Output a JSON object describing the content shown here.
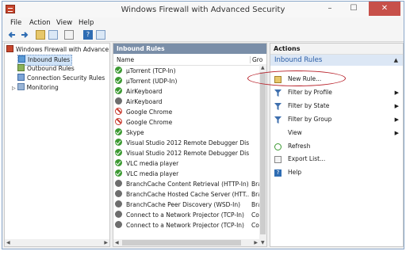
{
  "window": {
    "title": "Windows Firewall with Advanced Security",
    "minimize": "–",
    "maximize": "☐",
    "close": "✕"
  },
  "menu": [
    "File",
    "Action",
    "View",
    "Help"
  ],
  "tree": {
    "root": "Windows Firewall with Advance",
    "items": [
      "Inbound Rules",
      "Outbound Rules",
      "Connection Security Rules",
      "Monitoring"
    ]
  },
  "rules_pane": {
    "header": "Inbound Rules",
    "columns": {
      "name": "Name",
      "group": "Gro"
    },
    "rows": [
      {
        "name": "µTorrent (TCP-In)",
        "group": "",
        "status": "allow"
      },
      {
        "name": "µTorrent (UDP-In)",
        "group": "",
        "status": "allow"
      },
      {
        "name": "AirKeyboard",
        "group": "",
        "status": "allow"
      },
      {
        "name": "AirKeyboard",
        "group": "",
        "status": "none"
      },
      {
        "name": "Google Chrome",
        "group": "",
        "status": "block"
      },
      {
        "name": "Google Chrome",
        "group": "",
        "status": "block"
      },
      {
        "name": "Skype",
        "group": "",
        "status": "allow"
      },
      {
        "name": "Visual Studio 2012 Remote Debugger Dis...",
        "group": "",
        "status": "allow"
      },
      {
        "name": "Visual Studio 2012 Remote Debugger Dis...",
        "group": "",
        "status": "allow"
      },
      {
        "name": "VLC media player",
        "group": "",
        "status": "allow"
      },
      {
        "name": "VLC media player",
        "group": "",
        "status": "allow"
      },
      {
        "name": "BranchCache Content Retrieval (HTTP-In)",
        "group": "Bra",
        "status": "none"
      },
      {
        "name": "BranchCache Hosted Cache Server (HTT...",
        "group": "Bra",
        "status": "none"
      },
      {
        "name": "BranchCache Peer Discovery (WSD-In)",
        "group": "Bra",
        "status": "none"
      },
      {
        "name": "Connect to a Network Projector (TCP-In)",
        "group": "Co",
        "status": "none"
      },
      {
        "name": "Connect to a Network Projector (TCP-In)",
        "group": "Co",
        "status": "none"
      }
    ]
  },
  "actions_pane": {
    "title": "Actions",
    "section": "Inbound Rules",
    "items": [
      {
        "label": "New Rule...",
        "icon": "new-rule-icon",
        "submenu": false
      },
      {
        "label": "Filter by Profile",
        "icon": "filter-icon",
        "submenu": true
      },
      {
        "label": "Filter by State",
        "icon": "filter-icon",
        "submenu": true
      },
      {
        "label": "Filter by Group",
        "icon": "filter-icon",
        "submenu": true
      },
      {
        "label": "View",
        "icon": "",
        "submenu": true
      },
      {
        "label": "Refresh",
        "icon": "refresh-icon",
        "submenu": false
      },
      {
        "label": "Export List...",
        "icon": "export-icon",
        "submenu": false
      },
      {
        "label": "Help",
        "icon": "help-icon",
        "submenu": false
      }
    ]
  },
  "colors": {
    "accent": "#2a5da6",
    "pane_header": "#7a8ea8",
    "annotation": "#b8212a",
    "allow": "#3d9a33",
    "block": "#c83a2e"
  }
}
